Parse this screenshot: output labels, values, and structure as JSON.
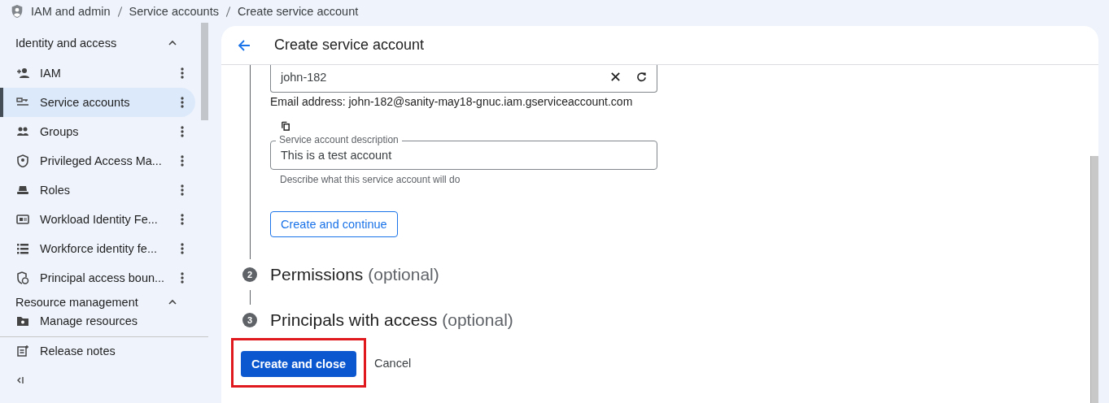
{
  "breadcrumb": [
    "IAM and admin",
    "Service accounts",
    "Create service account"
  ],
  "sidebar": {
    "sections": [
      {
        "title": "Identity and access",
        "expanded": true,
        "items": [
          {
            "label": "IAM",
            "selected": false
          },
          {
            "label": "Service accounts",
            "selected": true
          },
          {
            "label": "Groups",
            "selected": false
          },
          {
            "label": "Privileged Access Ma...",
            "selected": false
          },
          {
            "label": "Roles",
            "selected": false
          },
          {
            "label": "Workload Identity Fe...",
            "selected": false
          },
          {
            "label": "Workforce identity fe...",
            "selected": false
          },
          {
            "label": "Principal access boun...",
            "selected": false
          }
        ]
      },
      {
        "title": "Resource management",
        "expanded": true,
        "items": [
          {
            "label": "Manage resources",
            "selected": false
          }
        ]
      }
    ],
    "footer": [
      {
        "label": "Release notes"
      }
    ]
  },
  "page": {
    "title": "Create service account",
    "id_field": {
      "value": "john-182"
    },
    "email": "Email address: john-182@sanity-may18-gnuc.iam.gserviceaccount.com",
    "description_field": {
      "label": "Service account description",
      "value": "This is a test account",
      "hint": "Describe what this service account will do"
    },
    "continue_button": "Create and continue",
    "steps": [
      {
        "number": "2",
        "title": "Permissions",
        "note": "(optional)"
      },
      {
        "number": "3",
        "title": "Principals with access",
        "note": "(optional)"
      }
    ],
    "actions": [
      {
        "label": "Create and close",
        "kind": "primary",
        "highlighted": true
      },
      {
        "label": "Cancel",
        "kind": "text",
        "highlighted": false
      }
    ]
  }
}
